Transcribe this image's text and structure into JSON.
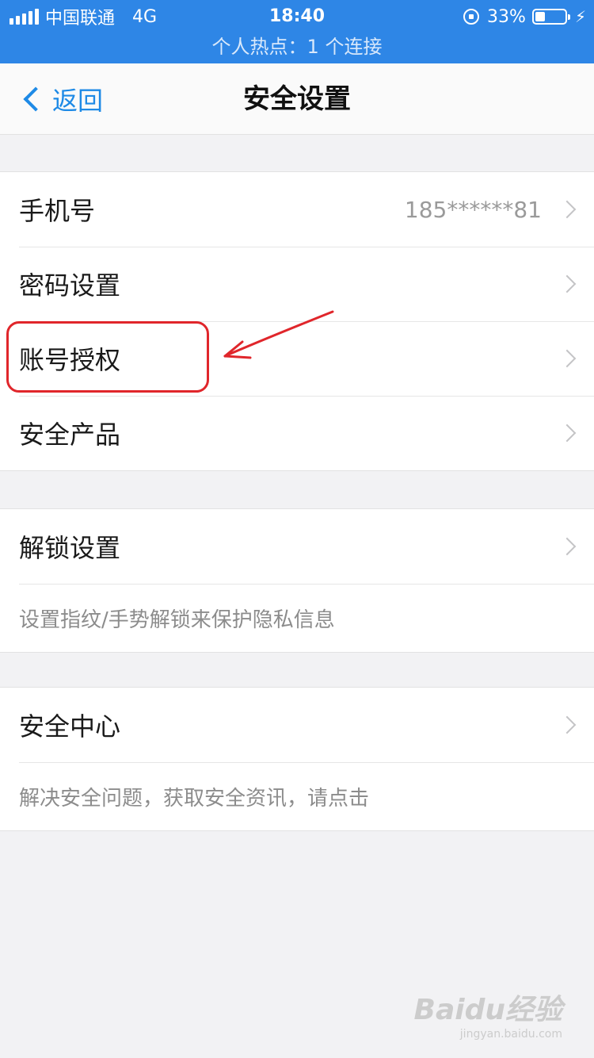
{
  "status_bar": {
    "carrier": "中国联通",
    "network": "4G",
    "time": "18:40",
    "battery": "33%",
    "battery_level": 0.33,
    "hotspot": "个人热点：1 个连接"
  },
  "nav": {
    "back_label": "返回",
    "title": "安全设置"
  },
  "group1": [
    {
      "label": "手机号",
      "value": "185******81"
    },
    {
      "label": "密码设置"
    },
    {
      "label": "账号授权"
    },
    {
      "label": "安全产品"
    }
  ],
  "group2": {
    "label": "解锁设置",
    "hint": "设置指纹/手势解锁来保护隐私信息"
  },
  "group3": {
    "label": "安全中心",
    "hint": "解决安全问题，获取安全资讯，请点击"
  },
  "watermark": {
    "brand": "Baidu经验",
    "url": "jingyan.baidu.com"
  },
  "colors": {
    "status_bar": "#2e86e6",
    "accent": "#1e8ae6",
    "annotation": "#e0262b"
  }
}
